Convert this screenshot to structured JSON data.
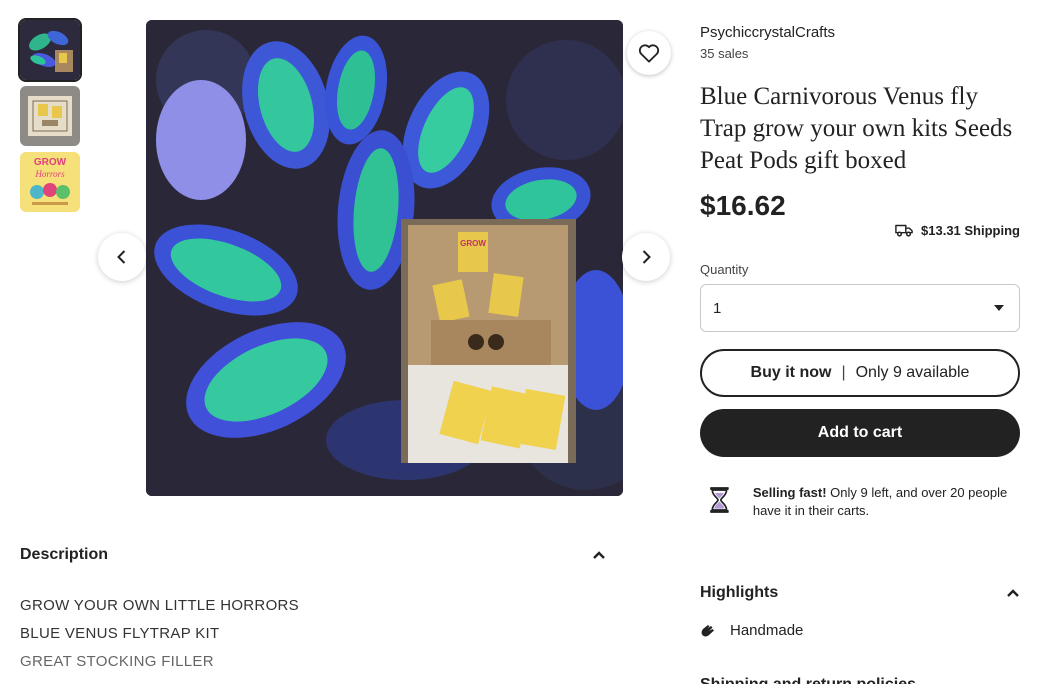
{
  "thumbnails": [
    {
      "name": "thumbnail-venus-flytrap",
      "selected": true
    },
    {
      "name": "thumbnail-kit-box",
      "selected": false
    },
    {
      "name": "thumbnail-grow-your-own-horrors",
      "selected": false,
      "text_line1": "GROW",
      "text_line2": "Horrors"
    }
  ],
  "main_image": {
    "alt_subject": "blue venus flytrap plant with kit inset",
    "inset_card_text": "GROW"
  },
  "icons": {
    "favorite": "heart-icon",
    "prev": "chevron-left-icon",
    "next": "chevron-right-icon",
    "shipping": "truck-icon",
    "dropdown": "caret-down-icon",
    "selling_fast": "hourglass-icon",
    "description_toggle": "chevron-up-icon",
    "highlights_toggle": "chevron-up-icon",
    "handmade": "hand-icon"
  },
  "listing": {
    "shop_name": "PsychiccrystalCrafts",
    "sales": "35 sales",
    "title": "Blue Carnivorous Venus fly Trap grow your own kits Seeds Peat Pods gift boxed",
    "price": "$16.62",
    "shipping": "$13.31 Shipping"
  },
  "purchase": {
    "quantity_label": "Quantity",
    "quantity_value": "1",
    "buy_now_label": "Buy it now",
    "buy_now_separator": "|",
    "availability": "Only 9 available",
    "add_to_cart_label": "Add to cart",
    "selling_fast_bold": "Selling fast!",
    "selling_fast_rest": " Only 9 left, and over 20 people have it in their carts."
  },
  "description": {
    "heading": "Description",
    "lines": [
      "GROW YOUR OWN LITTLE HORRORS",
      "BLUE VENUS FLYTRAP KIT",
      "GREAT STOCKING FILLER"
    ]
  },
  "highlights": {
    "heading": "Highlights",
    "items": [
      {
        "label": "Handmade"
      }
    ]
  },
  "next_section": {
    "heading_partial": "Shipping and return policies"
  },
  "colors": {
    "text": "#222222",
    "button_dark": "#222222",
    "border": "#c8c8c8",
    "hourglass_sand": "#b49ad8"
  }
}
